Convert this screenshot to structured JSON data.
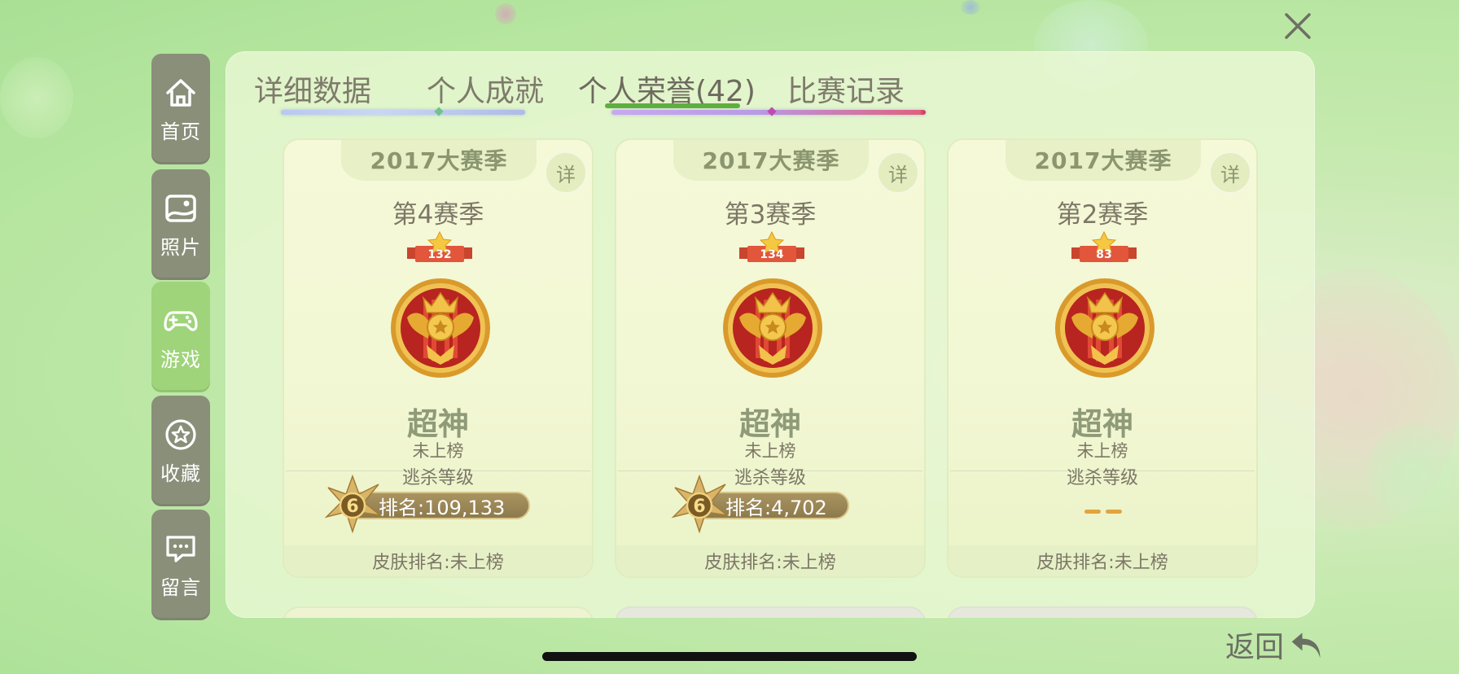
{
  "window": {
    "close_icon": "close-icon"
  },
  "sidebar": {
    "items": [
      {
        "label": "首页",
        "icon": "home-icon",
        "active": false
      },
      {
        "label": "照片",
        "icon": "photo-icon",
        "active": false
      },
      {
        "label": "游戏",
        "icon": "gamepad-icon",
        "active": true
      },
      {
        "label": "收藏",
        "icon": "star-icon",
        "active": false
      },
      {
        "label": "留言",
        "icon": "message-icon",
        "active": false
      }
    ]
  },
  "tabs": [
    {
      "label": "详细数据",
      "active": false
    },
    {
      "label": "个人成就",
      "active": false
    },
    {
      "label": "个人荣誉(42)",
      "active": true
    },
    {
      "label": "比赛记录",
      "active": false
    }
  ],
  "cards": [
    {
      "banner": "2017大赛季",
      "detail": "详",
      "season": "第4赛季",
      "star_count": "132",
      "rank_title": "超神",
      "rank_status": "未上榜",
      "level_label": "逃杀等级",
      "level_badge": "6",
      "rank_text": "排名:109,133",
      "skin_rank": "皮肤排名:未上榜"
    },
    {
      "banner": "2017大赛季",
      "detail": "详",
      "season": "第3赛季",
      "star_count": "134",
      "rank_title": "超神",
      "rank_status": "未上榜",
      "level_label": "逃杀等级",
      "level_badge": "6",
      "rank_text": "排名:4,702",
      "skin_rank": "皮肤排名:未上榜"
    },
    {
      "banner": "2017大赛季",
      "detail": "详",
      "season": "第2赛季",
      "star_count": "83",
      "rank_title": "超神",
      "rank_status": "未上榜",
      "level_label": "逃杀等级",
      "skin_rank": "皮肤排名:未上榜"
    }
  ],
  "footer": {
    "back_label": "返回",
    "back_icon": "return-arrow-icon"
  },
  "colors": {
    "accent": "#5fae3f",
    "sidebar_bg": "#8a8f7a",
    "sidebar_active": "#9fd47a",
    "pill": "#9c874f"
  }
}
